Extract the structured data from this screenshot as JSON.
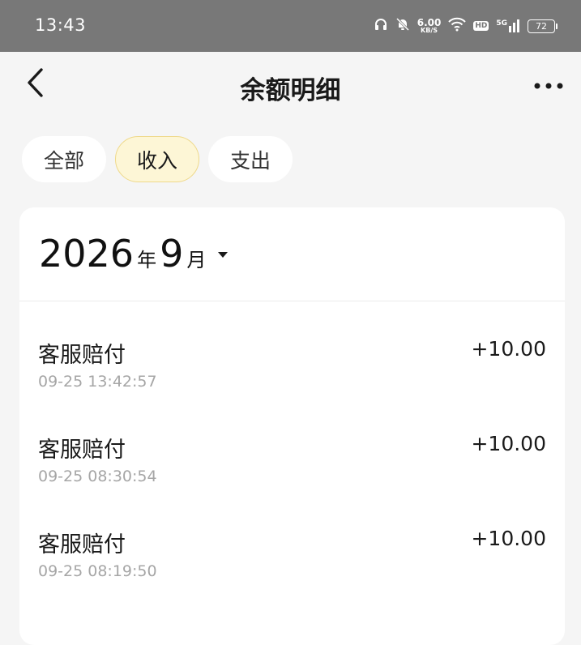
{
  "status_bar": {
    "time": "13:43",
    "net_speed_value": "6.00",
    "net_speed_unit": "KB/S",
    "hd_label": "HD",
    "signal_label": "5G",
    "battery": "72"
  },
  "header": {
    "title": "余额明细",
    "back_icon": "chevron-left-icon",
    "more_icon": "more-horizontal-icon"
  },
  "tabs": [
    {
      "label": "全部",
      "active": false
    },
    {
      "label": "收入",
      "active": true
    },
    {
      "label": "支出",
      "active": false
    }
  ],
  "month_picker": {
    "year": "2026",
    "year_unit": "年",
    "month": "9",
    "month_unit": "月"
  },
  "transactions": [
    {
      "title": "客服赔付",
      "time": "09-25 13:42:57",
      "amount": "+10.00"
    },
    {
      "title": "客服赔付",
      "time": "09-25 08:30:54",
      "amount": "+10.00"
    },
    {
      "title": "客服赔付",
      "time": "09-25 08:19:50",
      "amount": "+10.00"
    }
  ],
  "colors": {
    "status_bar_bg": "#787878",
    "page_bg": "#f5f5f5",
    "active_tab_bg": "#fdf6d6",
    "active_tab_border": "#efd98a",
    "secondary_text": "#a6a6a6"
  }
}
